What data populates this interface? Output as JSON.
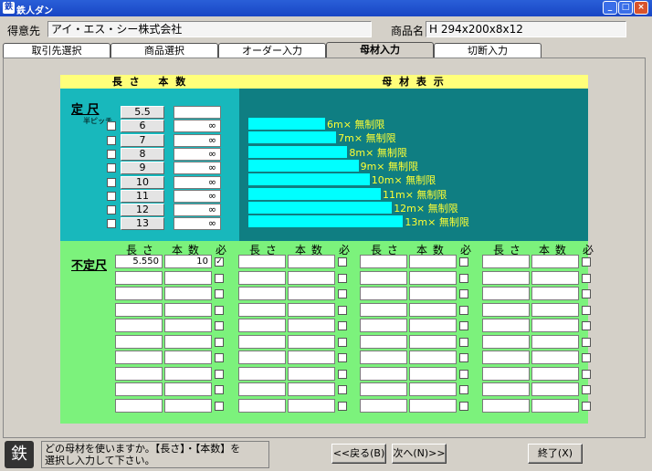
{
  "window": {
    "title": "鉄人ダン"
  },
  "header": {
    "customer_label": "得意先",
    "customer_value": "アイ・エス・シー株式会社",
    "product_label": "商品名",
    "product_value": "H 294x200x8x12"
  },
  "tabs": [
    {
      "label": "取引先選択"
    },
    {
      "label": "商品選択"
    },
    {
      "label": "オーダー入力"
    },
    {
      "label": "母材入力"
    },
    {
      "label": "切断入力"
    }
  ],
  "upper": {
    "length_header": "長 さ 　本 数",
    "display_header": "母 材 表 示",
    "fixed_label": "定 尺",
    "half_pitch_label": "半ピッチ",
    "lengths": [
      {
        "len": "5.5",
        "qty": ""
      },
      {
        "len": "6",
        "qty": "∞"
      },
      {
        "len": "7",
        "qty": "∞"
      },
      {
        "len": "8",
        "qty": "∞"
      },
      {
        "len": "9",
        "qty": "∞"
      },
      {
        "len": "10",
        "qty": "∞"
      },
      {
        "len": "11",
        "qty": "∞"
      },
      {
        "len": "12",
        "qty": "∞"
      },
      {
        "len": "13",
        "qty": "∞"
      }
    ],
    "bars": [
      {
        "label": "6m× 無制限",
        "length": 6
      },
      {
        "label": "7m× 無制限",
        "length": 7
      },
      {
        "label": "8m× 無制限",
        "length": 8
      },
      {
        "label": "9m× 無制限",
        "length": 9
      },
      {
        "label": "10m× 無制限",
        "length": 10
      },
      {
        "label": "11m× 無制限",
        "length": 11
      },
      {
        "label": "12m× 無制限",
        "length": 12
      },
      {
        "label": "13m× 無制限",
        "length": 13
      }
    ]
  },
  "lower": {
    "variable_label": "不定尺",
    "col_len": "長 さ",
    "col_qty": "本 数",
    "col_req": "必",
    "first_row": {
      "len": "5.550",
      "qty": "10",
      "checked": true
    }
  },
  "status": {
    "message_line1": "どの母材を使いますか。【長さ】・【本数】を",
    "message_line2": "選択し入力して下さい。"
  },
  "buttons": {
    "back": "<<戻る(B)",
    "next": "次へ(N)>>",
    "exit": "終了(X)"
  }
}
